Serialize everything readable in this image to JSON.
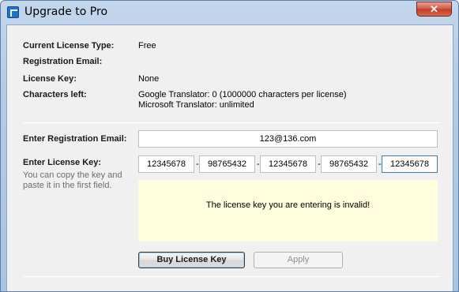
{
  "window": {
    "title": "Upgrade to Pro",
    "close_glyph": "✕"
  },
  "info": {
    "license_type_label": "Current License Type:",
    "license_type_value": "Free",
    "reg_email_label": "Registration Email:",
    "reg_email_value": "",
    "license_key_label": "License Key:",
    "license_key_value": "None",
    "chars_left_label": "Characters left:",
    "chars_google": "Google Translator: 0 (1000000 characters per license)",
    "chars_microsoft": "Microsoft Translator: unlimited"
  },
  "form": {
    "email_label": "Enter Registration Email:",
    "email_value": "123@136.com",
    "key_label": "Enter License Key:",
    "key_hint": "You can copy the key and paste it in the first field.",
    "key_parts": [
      "12345678",
      "98765432",
      "12345678",
      "98765432",
      "12345678"
    ],
    "key_separator": "-",
    "message": "The license key you are entering is invalid!"
  },
  "buttons": {
    "buy": "Buy License Key",
    "apply": "Apply"
  }
}
